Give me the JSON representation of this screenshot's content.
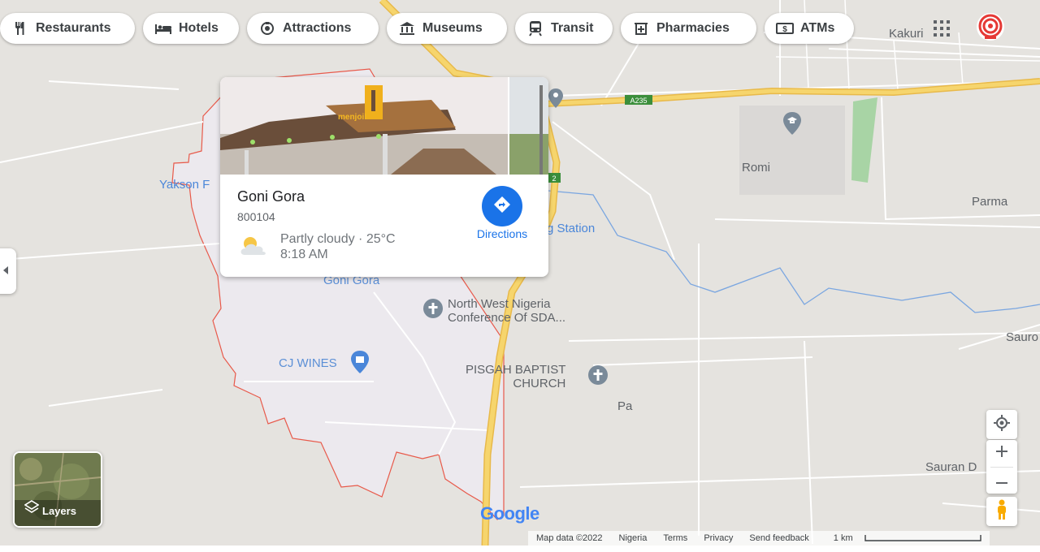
{
  "categories": [
    {
      "label": "Restaurants",
      "icon": "fork-knife-icon"
    },
    {
      "label": "Hotels",
      "icon": "bed-icon"
    },
    {
      "label": "Attractions",
      "icon": "camera-icon"
    },
    {
      "label": "Museums",
      "icon": "museum-icon"
    },
    {
      "label": "Transit",
      "icon": "train-icon"
    },
    {
      "label": "Pharmacies",
      "icon": "pharmacy-icon"
    },
    {
      "label": "ATMs",
      "icon": "atm-icon"
    }
  ],
  "place_card": {
    "name": "Goni Gora",
    "postal_code": "800104",
    "weather_condition": "Partly cloudy · 25°C",
    "weather_time": "8:18 AM",
    "directions_label": "Directions",
    "photo_sign": "menjoil"
  },
  "map_labels": {
    "kakuri": "Kakuri",
    "romi": "Romi",
    "parma": "Parma",
    "yakson": "Yakson F",
    "station": "g Station",
    "goni_gora": "Goni Gora",
    "sda_line1": "North West Nigeria",
    "sda_line2": "Conference Of SDA...",
    "cj_wines": "CJ WINES",
    "pisgah_line1": "PISGAH BAPTIST",
    "pisgah_line2": "CHURCH",
    "pa": "Pa",
    "sauro": "Sauro",
    "sauran_d": "Sauran D",
    "road_a235": "A235",
    "road_a2": "2"
  },
  "layers_label": "Layers",
  "google_logo": "Google",
  "footer": {
    "map_data": "Map data ©2022",
    "country": "Nigeria",
    "terms": "Terms",
    "privacy": "Privacy",
    "feedback": "Send feedback",
    "scale": "1 km"
  },
  "colors": {
    "map_bg": "#e5e3df",
    "highway": "#f6d56d",
    "highway_edge": "#e8b94a",
    "boundary": "#e8594a",
    "river": "#7aa6e0",
    "accent": "#1a73e8"
  }
}
